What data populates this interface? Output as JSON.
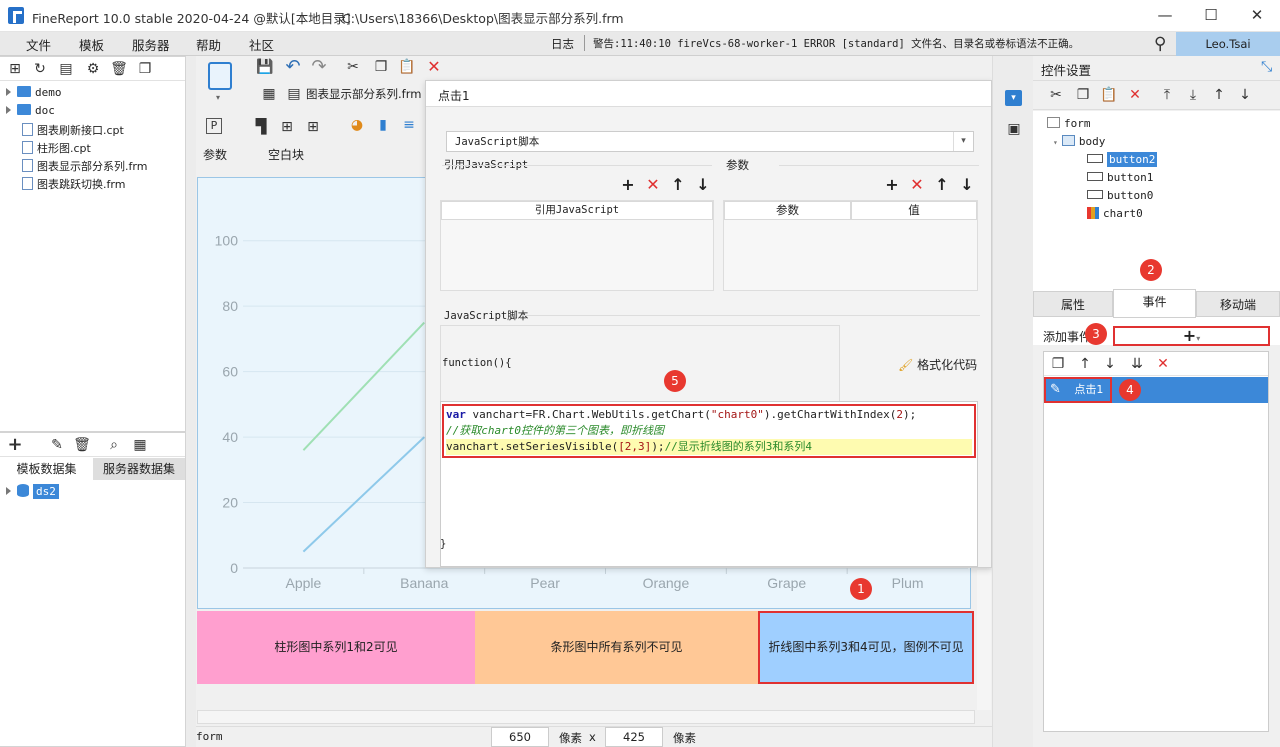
{
  "window": {
    "title": "FineReport 10.0 stable 2020-04-24 @默认[本地目录]",
    "path": "C:\\Users\\18366\\Desktop\\图表显示部分系列.frm",
    "minimize": "—",
    "maximize": "☐",
    "close": "✕"
  },
  "menu": {
    "items": [
      "文件",
      "模板",
      "服务器",
      "帮助",
      "社区"
    ],
    "log_label": "日志",
    "log_message": "警告:11:40:10 fireVcs-68-worker-1 ERROR [standard] 文件名、目录名或卷标语法不正确。",
    "user": "Leo.Tsai"
  },
  "file_tree": {
    "items": [
      {
        "type": "folder",
        "name": "demo"
      },
      {
        "type": "folder",
        "name": "doc"
      },
      {
        "type": "file",
        "name": "图表刷新接口.cpt"
      },
      {
        "type": "file",
        "name": "柱形图.cpt"
      },
      {
        "type": "file",
        "name": "图表显示部分系列.frm"
      },
      {
        "type": "file",
        "name": "图表跳跃切换.frm"
      }
    ]
  },
  "dataset": {
    "tabs": [
      "模板数据集",
      "服务器数据集"
    ],
    "items": [
      "ds2"
    ]
  },
  "editor": {
    "tab_name": "图表显示部分系列.frm",
    "param_label": "参数",
    "blank_label": "空白块"
  },
  "chart_data": {
    "type": "line",
    "categories": [
      "Apple",
      "Banana",
      "Pear",
      "Orange",
      "Grape",
      "Plum"
    ],
    "yticks": [
      "0",
      "20",
      "40",
      "60",
      "80",
      "100"
    ],
    "ylim": [
      0,
      110
    ],
    "series": [
      {
        "color": "#9fe0b4",
        "values": [
          36,
          75
        ]
      },
      {
        "color": "#8ec9ea",
        "values": [
          5,
          40
        ]
      }
    ]
  },
  "buttons": [
    {
      "label": "柱形图中系列1和2可见",
      "color": "#ff9fcf"
    },
    {
      "label": "条形图中所有系列不可见",
      "color": "#ffc896"
    },
    {
      "label": "折线图中系列3和4可见，图例不可见",
      "color": "#9fcfff"
    }
  ],
  "dialog": {
    "title": "点击1",
    "script_type": "JavaScript脚本",
    "ref_js_label": "引用JavaScript",
    "params_label": "参数",
    "ref_js_col": "引用JavaScript",
    "param_col": "参数",
    "value_col": "值",
    "script_section": "JavaScript脚本",
    "function_open": "function(){",
    "format_code": "格式化代码",
    "code_lines": [
      {
        "kw": "var",
        "text": " vanchart=FR.Chart.WebUtils.getChart(",
        "str": "\"chart0\"",
        "tail": ").getChartWithIndex(",
        "num": "2",
        "end": ");"
      },
      {
        "comment": "//获取chart0控件的第三个图表，即折线图"
      },
      {
        "text": "vanchart.setSeriesVisible(",
        "arr": "[2,3]",
        "end2": ");",
        "comment2": "//显示折线图的系列3和系列4"
      }
    ],
    "function_close": "}"
  },
  "right": {
    "title": "控件设置",
    "tree": [
      "form",
      "body",
      "button2",
      "button1",
      "button0",
      "chart0"
    ],
    "tabs": [
      "属性",
      "事件",
      "移动端"
    ],
    "add_event": "添加事件",
    "add_symbol": "+",
    "event_item": "点击1"
  },
  "badges": [
    "1",
    "2",
    "3",
    "4",
    "5"
  ],
  "status": {
    "name": "form",
    "width": "650",
    "height": "425",
    "unit": "像素",
    "x": "x"
  }
}
